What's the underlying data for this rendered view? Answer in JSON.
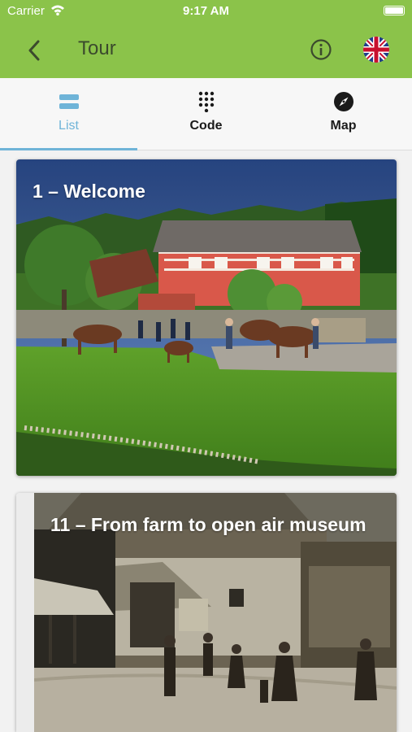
{
  "status_bar": {
    "carrier": "Carrier",
    "time": "9:17 AM"
  },
  "nav": {
    "title": "Tour",
    "back_icon": "chevron-left-icon",
    "info_icon": "info-icon",
    "flag_icon": "uk-flag-icon"
  },
  "tabs": [
    {
      "label": "List",
      "icon": "list-icon",
      "active": true
    },
    {
      "label": "Code",
      "icon": "keypad-icon",
      "active": false
    },
    {
      "label": "Map",
      "icon": "compass-icon",
      "active": false
    }
  ],
  "colors": {
    "nav": "#8bc34a",
    "accent": "#6fb4d8"
  },
  "stops": [
    {
      "title": "1 – Welcome"
    },
    {
      "title": "11 – From farm to open air museum"
    }
  ]
}
